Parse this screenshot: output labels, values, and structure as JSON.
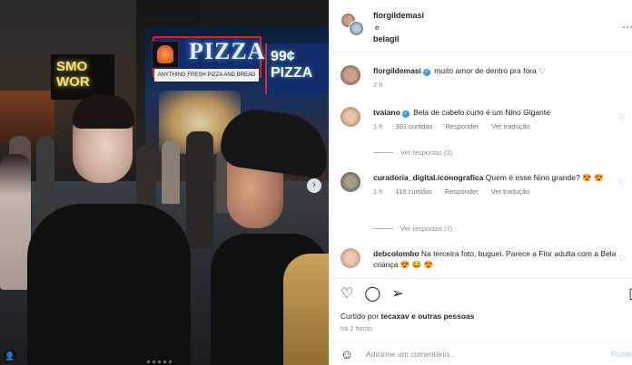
{
  "photo": {
    "signs": {
      "pizza": "PIZZA",
      "pizza_sub": "ANYTHING FRESH PIZZA AND BREAD",
      "pizza99": "99¢ PIZZA",
      "smoke": "SMO WOR"
    },
    "carousel": {
      "count": 5,
      "active_index": 0
    }
  },
  "header": {
    "user1": "florgildemasi",
    "conjunction": "e",
    "user2": "belagil",
    "more_icon": "more-horizontal-icon"
  },
  "caption": {
    "username": "florgildemasi",
    "verified": true,
    "text": "muito amor de dentro pra fora ♡",
    "time": "2 h"
  },
  "comments": [
    {
      "username": "tvaiano",
      "verified": true,
      "text": "Bela de cabelo curto é um Nino Gigante",
      "time": "1 h",
      "likes": "381 curtidas",
      "reply": "Responder",
      "translate": "Ver tradução",
      "replies": "Ver respostas (2)"
    },
    {
      "username": "curadoria_digital.iconografica",
      "verified": false,
      "text": "Quem é esse Nino grande? 😍 😍",
      "time": "1 h",
      "likes": "116 curtidas",
      "reply": "Responder",
      "translate": "Ver tradução",
      "replies": "Ver respostas (7)"
    },
    {
      "username": "debcolombo",
      "verified": false,
      "text": "Na terceira foto, buguei. Parece a Flor adulta com a Bela criança 😍 😂 😍"
    }
  ],
  "actions": {
    "liked_prefix": "Curtido por",
    "liked_user": "tecaxav",
    "liked_suffix": "e outras pessoas",
    "time": "há 2 horas"
  },
  "add_comment": {
    "placeholder": "Adicione um comentário...",
    "post_label": "Publicar"
  }
}
